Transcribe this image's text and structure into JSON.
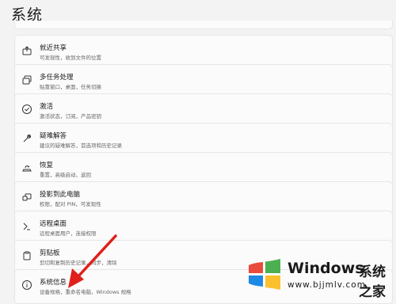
{
  "page": {
    "title": "系统"
  },
  "items": [
    {
      "label": "就近共享",
      "desc": "可发现性，收到文件的位置",
      "icon": "share-icon"
    },
    {
      "label": "多任务处理",
      "desc": "贴靠窗口，桌面，任务切换",
      "icon": "multitask-icon"
    },
    {
      "label": "激活",
      "desc": "激活状态，订阅，产品密钥",
      "icon": "activation-icon"
    },
    {
      "label": "疑难解答",
      "desc": "建议的疑难解答，首选项和历史记录",
      "icon": "troubleshoot-icon"
    },
    {
      "label": "恢复",
      "desc": "重置，高级启动，返回",
      "icon": "recovery-icon"
    },
    {
      "label": "投影到此电脑",
      "desc": "权限，配对 PIN，可发现性",
      "icon": "projection-icon"
    },
    {
      "label": "远程桌面",
      "desc": "远程桌面用户，连接权限",
      "icon": "remote-desktop-icon"
    },
    {
      "label": "剪贴板",
      "desc": "剪切和复制历史记录，同步，清除",
      "icon": "clipboard-icon"
    },
    {
      "label": "系统信息",
      "desc": "设备规格，重命名电脑，Windows 规格",
      "icon": "info-icon"
    }
  ],
  "watermark": {
    "brand": "Windows",
    "cn": "系统之家",
    "url": "www.bjjmlv.com"
  },
  "colors": {
    "annotation_arrow": "#e0201b",
    "background": "#f3f3f3",
    "card": "#fbfbfb"
  }
}
